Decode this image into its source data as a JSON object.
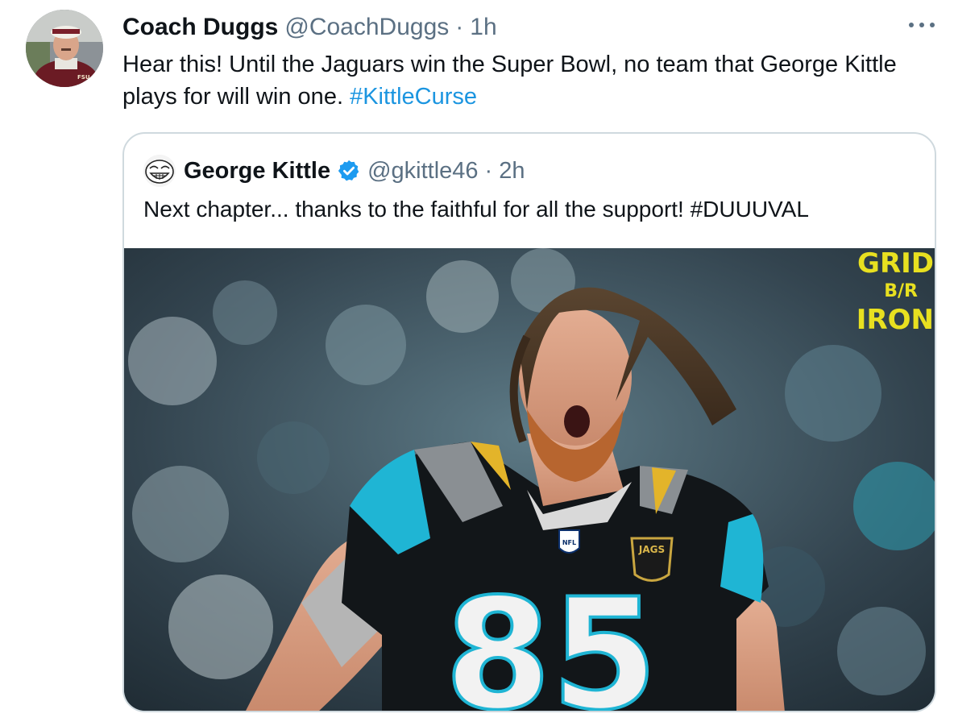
{
  "tweet": {
    "display_name": "Coach Duggs",
    "handle": "@CoachDuggs",
    "separator": "·",
    "time": "1h",
    "text_plain": "Hear this! Until the Jaguars win the Super Bowl, no team that George Kittle plays for will win one. ",
    "hashtag": "#KittleCurse",
    "avatar_icon": "profile-photo-icon",
    "avatar_badge": "FSU",
    "more_icon": "more-options-icon"
  },
  "quoted_tweet": {
    "display_name": "George Kittle",
    "verified_icon": "verified-badge-icon",
    "handle": "@gkittle46",
    "separator": "·",
    "time": "2h",
    "text": "Next chapter... thanks to the faithful for all the support! #DUUUVAL",
    "avatar_icon": "trollface-avatar-icon",
    "media": {
      "description_icon": "football-player-photo",
      "jersey_number": "85",
      "chest_logo": "JAGS",
      "collar_logo": "NFL",
      "watermark_line1": "GRID",
      "watermark_line2": "B/R",
      "watermark_line3": "IRON"
    }
  },
  "colors": {
    "link": "#1b95e0",
    "secondary_text": "#5b7083",
    "border": "#cfd9de",
    "teal": "#1fb5d4",
    "watermark": "#e8e020"
  }
}
